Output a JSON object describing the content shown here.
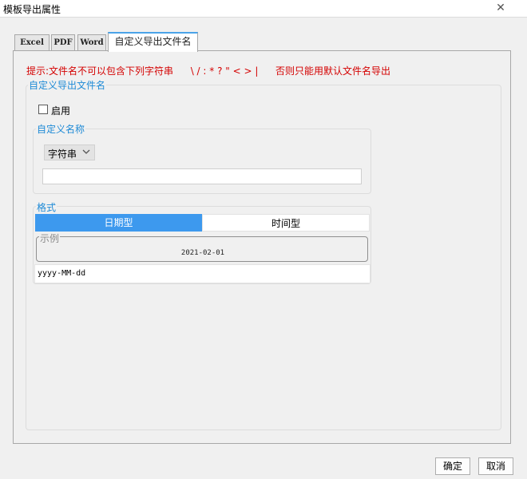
{
  "window": {
    "title": "模板导出属性",
    "close_glyph": "✕"
  },
  "tabs": [
    {
      "label": "Excel",
      "active": false
    },
    {
      "label": "PDF",
      "active": false
    },
    {
      "label": "Word",
      "active": false
    },
    {
      "label": "自定义导出文件名",
      "active": true
    }
  ],
  "hint": {
    "prefix": "提示:文件名不可以包含下列字符串",
    "chars": "\\ / : * ? \" < > |",
    "suffix": "否则只能用默认文件名导出"
  },
  "section": {
    "legend": "自定义导出文件名",
    "enable_label": "启用",
    "enable_checked": false
  },
  "name_group": {
    "legend": "自定义名称",
    "type_value": "字符串",
    "text_value": ""
  },
  "format_group": {
    "legend": "格式",
    "options": [
      "日期型",
      "时间型"
    ],
    "selected": "日期型",
    "example_legend": "示例",
    "example_value": "2021-02-01",
    "pattern": "yyyy-MM-dd"
  },
  "buttons": {
    "ok": "确定",
    "cancel": "取消"
  },
  "colors": {
    "accent": "#3d99ee",
    "hint": "#d40000",
    "legend": "#1e8ad6"
  }
}
